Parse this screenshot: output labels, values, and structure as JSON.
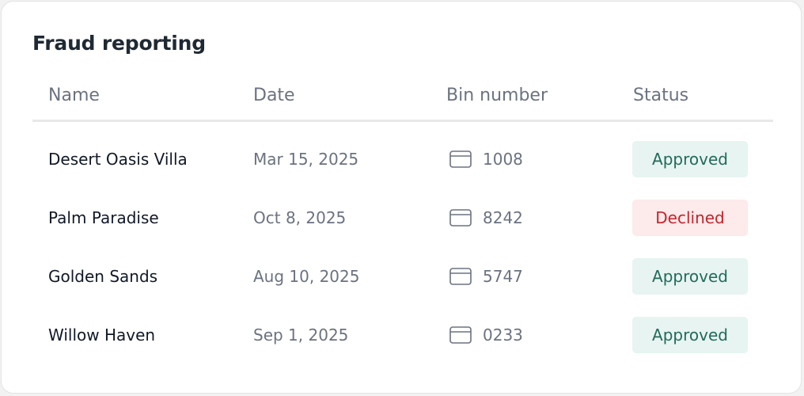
{
  "title": "Fraud reporting",
  "columns": {
    "name": "Name",
    "date": "Date",
    "bin": "Bin number",
    "status": "Status"
  },
  "rows": [
    {
      "name": "Desert Oasis Villa",
      "date": "Mar 15, 2025",
      "bin": "1008",
      "status": "Approved"
    },
    {
      "name": "Palm Paradise",
      "date": "Oct 8, 2025",
      "bin": "8242",
      "status": "Declined"
    },
    {
      "name": "Golden Sands",
      "date": "Aug 10, 2025",
      "bin": "5747",
      "status": "Approved"
    },
    {
      "name": "Willow Haven",
      "date": "Sep 1, 2025",
      "bin": "0233",
      "status": "Approved"
    }
  ],
  "icons": {
    "bin": "credit-card-icon"
  },
  "colors": {
    "approved_bg": "#e7f4f2",
    "approved_text": "#236a5a",
    "declined_bg": "#fdeaea",
    "declined_text": "#c0262d"
  }
}
